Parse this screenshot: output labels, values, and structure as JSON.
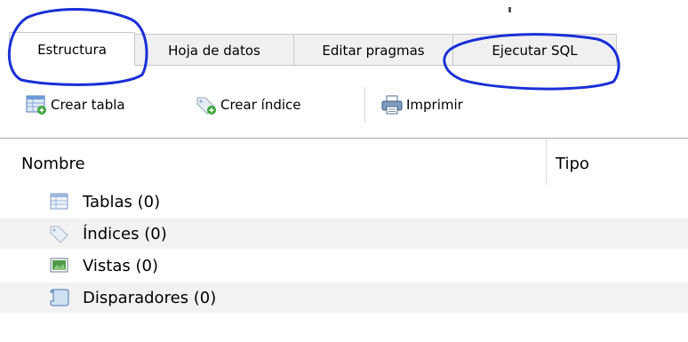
{
  "tabs": [
    {
      "label": "Estructura",
      "active": true
    },
    {
      "label": "Hoja de datos",
      "active": false
    },
    {
      "label": "Editar pragmas",
      "active": false
    },
    {
      "label": "Ejecutar SQL",
      "active": false
    }
  ],
  "toolbar": {
    "create_table": {
      "label": "Crear tabla",
      "icon": "table-add-icon"
    },
    "create_index": {
      "label": "Crear índice",
      "icon": "tag-add-icon"
    },
    "print": {
      "label": "Imprimir",
      "icon": "printer-icon"
    }
  },
  "tree": {
    "columns": {
      "name": "Nombre",
      "type": "Tipo"
    },
    "rows": [
      {
        "label": "Tablas (0)",
        "icon": "table-icon"
      },
      {
        "label": "Índices (0)",
        "icon": "tag-icon"
      },
      {
        "label": "Vistas (0)",
        "icon": "view-icon"
      },
      {
        "label": "Disparadores (0)",
        "icon": "script-icon"
      }
    ]
  },
  "colors": {
    "annotation_ink": "#1a2fd6",
    "tab_border": "#c9c9c9",
    "row_alt": "#f2f2f2"
  }
}
